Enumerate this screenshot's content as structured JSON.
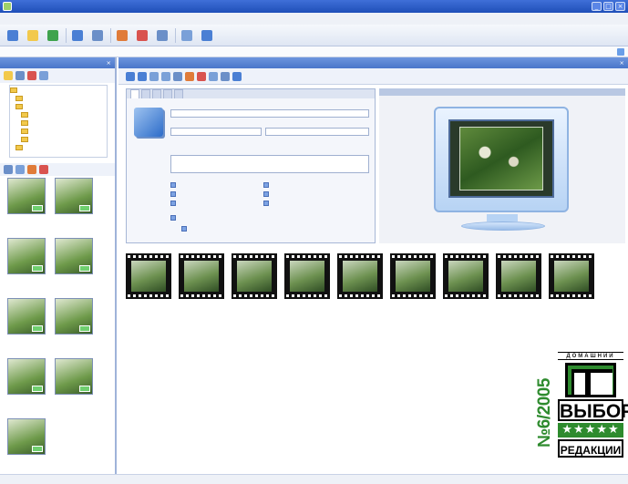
{
  "window": {
    "title": ""
  },
  "menubar": {
    "items": [
      "",
      "",
      "",
      "",
      "",
      "",
      ""
    ]
  },
  "toolbar": {
    "items": [
      {
        "icon": "back-icon",
        "color": "#4a7fd4",
        "label": ""
      },
      {
        "icon": "folder-icon",
        "color": "#f2c94c",
        "label": ""
      },
      {
        "icon": "globe-icon",
        "color": "#3fa34d",
        "label": ""
      },
      {
        "icon": "view-icon",
        "color": "#4a7fd4",
        "label": ""
      },
      {
        "icon": "scissors-icon",
        "color": "#6b8fc8",
        "label": ""
      },
      {
        "icon": "people-icon",
        "color": "#e07b39",
        "label": ""
      },
      {
        "icon": "heart-icon",
        "color": "#d9534f",
        "label": ""
      },
      {
        "icon": "image-icon",
        "color": "#6b8fc8",
        "label": ""
      },
      {
        "icon": "gear-icon",
        "color": "#7aa0d8",
        "label": ""
      },
      {
        "icon": "export-icon",
        "color": "#4a7fd4",
        "label": ""
      }
    ]
  },
  "address": {
    "path": ""
  },
  "left_panel": {
    "title": "",
    "tree": [
      "",
      "",
      "",
      "",
      "",
      "",
      "",
      ""
    ]
  },
  "left_thumbs": [
    "",
    "",
    "",
    "",
    "",
    "",
    "",
    "",
    ""
  ],
  "right_panel": {
    "title": ""
  },
  "properties": {
    "tabs": [
      "",
      "",
      "",
      "",
      ""
    ],
    "field_labels": [
      "",
      "",
      "",
      ""
    ],
    "field_values": [
      "",
      "",
      "",
      ""
    ],
    "checks": [
      "",
      "",
      "",
      "",
      "",
      "",
      "",
      ""
    ]
  },
  "preview": {
    "title": ""
  },
  "filmstrip": [
    "",
    "",
    "",
    "",
    "",
    "",
    "",
    "",
    ""
  ],
  "status": {
    "left": "",
    "right1": "",
    "right2": ""
  },
  "badge": {
    "issue": "№6/2005",
    "top": "ДОМАШНИЙ",
    "title": "ВЫБОР",
    "stars": "★★★★★",
    "bottom": "РЕДАКЦИИ"
  }
}
